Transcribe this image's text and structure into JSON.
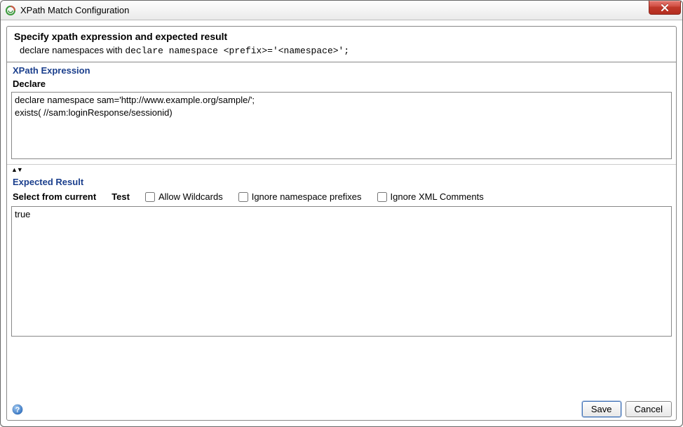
{
  "window": {
    "title": "XPath Match Configuration"
  },
  "spec": {
    "title": "Specify xpath expression and expected result",
    "desc_prefix": "declare namespaces with ",
    "desc_code": "declare namespace <prefix>='<namespace>';"
  },
  "xpath": {
    "section_label": "XPath Expression",
    "declare_label": "Declare",
    "value": "declare namespace sam='http://www.example.org/sample/';\nexists( //sam:loginResponse/sessionid)"
  },
  "expected": {
    "section_label": "Expected Result",
    "select_from_current": "Select from current",
    "test": "Test",
    "allow_wildcards": "Allow Wildcards",
    "ignore_ns_prefixes": "Ignore namespace prefixes",
    "ignore_xml_comments": "Ignore XML Comments",
    "value": "true"
  },
  "footer": {
    "save": "Save",
    "cancel": "Cancel"
  }
}
